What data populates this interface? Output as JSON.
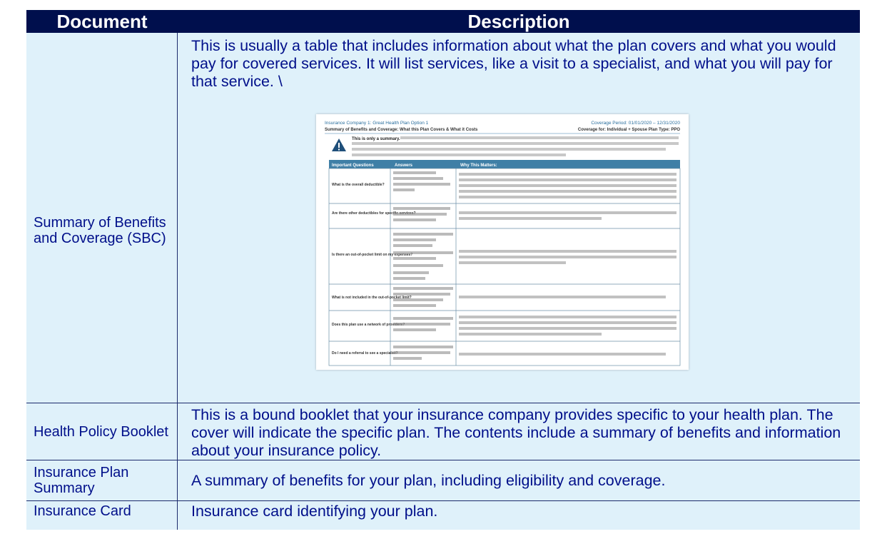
{
  "table": {
    "headers": [
      "Document",
      "Description"
    ],
    "rows": [
      {
        "document": "Summary of Benefits and Coverage (SBC)",
        "description": "This is usually a table that includes information about what the plan covers and what you would pay for covered services. It will list services, like a visit to a specialist, and what you will pay for that service. \\"
      },
      {
        "document": "Health Policy Booklet",
        "description": "This is a bound booklet that your insurance company provides specific to your health plan. The cover will indicate the specific plan. The contents include a summary of benefits and information about your insurance policy."
      },
      {
        "document": "Insurance Plan Summary",
        "description": "A summary of benefits for your plan, including eligibility and coverage."
      },
      {
        "document": "Insurance Card",
        "description": "Insurance card identifying your plan."
      }
    ]
  },
  "sbc_image": {
    "header_left": "Insurance Company 1: Great Health Plan Option 1",
    "header_right": "Coverage Period: 01/01/2020 – 12/31/2020",
    "subheader_left": "Summary of Benefits and Coverage: What this Plan Covers & What it Costs",
    "subheader_right": "Coverage for: Individual + Spouse  Plan Type: PPO",
    "notice_label": "This is only a summary.",
    "columns": [
      "Important Questions",
      "Answers",
      "Why This Matters:"
    ],
    "questions": [
      "What is the overall deductible?",
      "Are there other deductibles for specific services?",
      "Is there an out-of-pocket limit on my expenses?",
      "What is not included in the out-of-pocket limit?",
      "Does this plan use a network of providers?",
      "Do I need a referral to see a specialist?"
    ],
    "colors": {
      "header_bar": "#3f7fa6",
      "title_text": "#2a6f9e",
      "warning": "#1f4f7a"
    }
  },
  "colors": {
    "header_bg": "#000f4d",
    "row_bg": "#dff1fa",
    "text": "#000f8a",
    "border": "#1b2a6b"
  }
}
